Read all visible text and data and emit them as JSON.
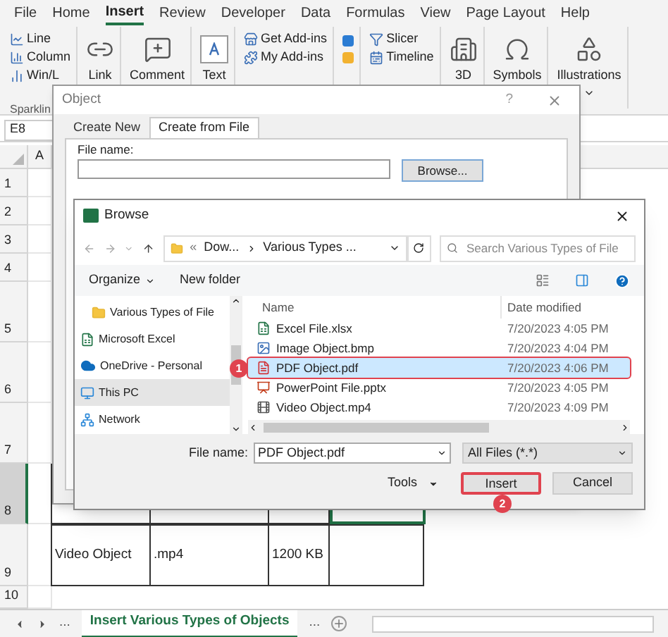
{
  "ribbon": {
    "tabs": [
      {
        "label": "File",
        "selected": false
      },
      {
        "label": "Home",
        "selected": false
      },
      {
        "label": "Insert",
        "selected": true
      },
      {
        "label": "Review",
        "selected": false
      },
      {
        "label": "Developer",
        "selected": false
      },
      {
        "label": "Data",
        "selected": false
      },
      {
        "label": "Formulas",
        "selected": false
      },
      {
        "label": "View",
        "selected": false
      },
      {
        "label": "Page Layout",
        "selected": false
      },
      {
        "label": "Help",
        "selected": false
      }
    ],
    "groups": [
      {
        "kind": "stack",
        "items": [
          "Line",
          "Column",
          "Win/L"
        ],
        "caption": "Sparklin"
      },
      {
        "kind": "large",
        "label": "Link"
      },
      {
        "kind": "large",
        "label": "Comment"
      },
      {
        "kind": "large",
        "label": "Text"
      },
      {
        "kind": "stack",
        "items": [
          "Get Add-ins",
          "My Add-ins"
        ]
      },
      {
        "kind": "apps"
      },
      {
        "kind": "stack",
        "items": [
          "Slicer",
          "Timeline"
        ]
      },
      {
        "kind": "large",
        "label": "3D"
      },
      {
        "kind": "large",
        "label": "Symbols"
      },
      {
        "kind": "large",
        "label": "Illustrations",
        "dropdown": true
      }
    ]
  },
  "formula_bar": {
    "name_box": "E8"
  },
  "sheet": {
    "column_headers": [
      "A"
    ],
    "rows": [
      {
        "number": "1"
      },
      {
        "number": "2"
      },
      {
        "number": "3"
      },
      {
        "number": "4"
      },
      {
        "number": "5"
      },
      {
        "number": "6"
      },
      {
        "number": "7"
      },
      {
        "number": "8",
        "cells": [
          {
            "selected": false
          },
          {
            "selected": false
          },
          {
            "selected": false
          },
          {
            "selected": true
          }
        ]
      },
      {
        "number": "9",
        "cells": [
          {
            "text": "Video Object",
            "selected": false
          },
          {
            "text": ".mp4",
            "selected": false
          },
          {
            "text": "1200 KB",
            "selected": false
          },
          {
            "selected": false
          }
        ]
      },
      {
        "number": "10"
      }
    ]
  },
  "sheet_tabs": {
    "more_left": "...",
    "tabs": [
      {
        "label": "Insert Various Types of Objects",
        "selected": true
      }
    ],
    "more_right": "..."
  },
  "object_dialog": {
    "title": "Object",
    "help": "?",
    "tabs": [
      {
        "label": "Create New",
        "selected": false
      },
      {
        "label": "Create from File",
        "selected": true
      }
    ],
    "file_name_label": "File name:",
    "browse_button": "Browse..."
  },
  "browse_dialog": {
    "title": "Browse",
    "address_prefix": "«",
    "address": [
      "Dow...",
      "Various Types ..."
    ],
    "search": {
      "placeholder": "Search Various Types of File"
    },
    "organize": "Organize",
    "new_folder": "New folder",
    "nav_pane": [
      {
        "kind": "folder",
        "label": "Various Types of File",
        "selected": false
      },
      {
        "kind": "excel",
        "label": "Microsoft Excel",
        "selected": false
      },
      {
        "kind": "cloud",
        "label": "OneDrive - Personal",
        "selected": false
      },
      {
        "kind": "pc",
        "label": "This PC",
        "selected": true
      },
      {
        "kind": "network",
        "label": "Network",
        "selected": false
      }
    ],
    "columns": [
      "Name",
      "Date modified"
    ],
    "files": [
      {
        "kind": "xlsx",
        "name": "Excel File.xlsx",
        "date": "7/20/2023 4:05 PM",
        "selected": false,
        "highlighted": false
      },
      {
        "kind": "bmp",
        "name": "Image Object.bmp",
        "date": "7/20/2023 4:04 PM",
        "selected": false,
        "highlighted": false
      },
      {
        "kind": "pdf",
        "name": "PDF Object.pdf",
        "date": "7/20/2023 4:06 PM",
        "selected": true,
        "highlighted": true,
        "step": "1"
      },
      {
        "kind": "pptx",
        "name": "PowerPoint File.pptx",
        "date": "7/20/2023 4:05 PM",
        "selected": false,
        "highlighted": false
      },
      {
        "kind": "mp4",
        "name": "Video Object.mp4",
        "date": "7/20/2023 4:09 PM",
        "selected": false,
        "highlighted": false
      }
    ],
    "file_name_label": "File name:",
    "file_name": "PDF Object.pdf",
    "file_type": "All Files (*.*)",
    "tools": "Tools",
    "insert": {
      "label": "Insert",
      "highlighted": true,
      "step": "2"
    },
    "cancel": "Cancel"
  }
}
